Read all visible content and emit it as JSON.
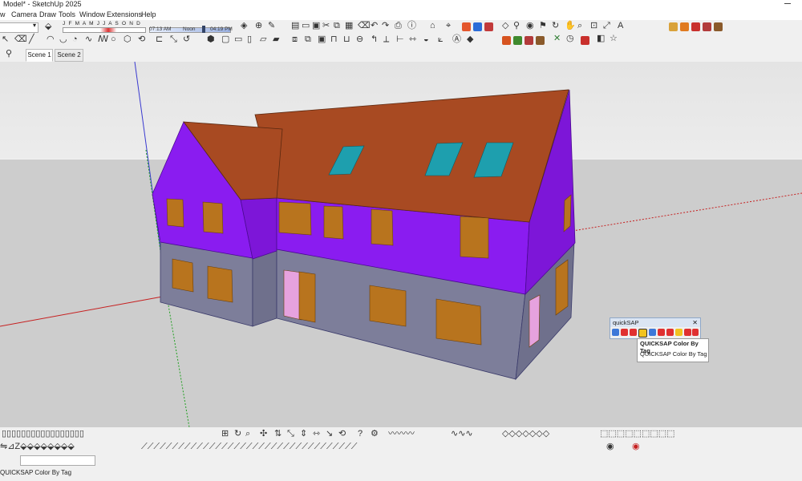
{
  "window": {
    "title": "Model* - SketchUp 2025"
  },
  "menu": [
    "w",
    "Camera",
    "Draw",
    "Tools",
    "Window",
    "Extensions",
    "Help"
  ],
  "shadow_settings": {
    "months": "J F M A M J J A S O N D",
    "time_start": "07:13 AM",
    "time_noon": "Noon",
    "time_end": "04:19 PM"
  },
  "scenes": {
    "tabs": [
      "Scene 1",
      "Scene 2"
    ],
    "active_index": 0
  },
  "quicksap": {
    "title": "quickSAP",
    "tooltip_title": "QUICKSAP Color By Tag",
    "tooltip_desc": "QUICKSAP Color By Tag"
  },
  "status": {
    "text": "QUICKSAP Color By Tag"
  },
  "colors": {
    "walls_upper": "#8a1cf0",
    "walls_lower": "#7d7e9a",
    "roof": "#a84a22",
    "windows": "#b8741e",
    "skylights": "#1e9fae",
    "doors": "#e6a2de",
    "ground": "#cdcdcd",
    "sky": "#e8e8e8"
  }
}
